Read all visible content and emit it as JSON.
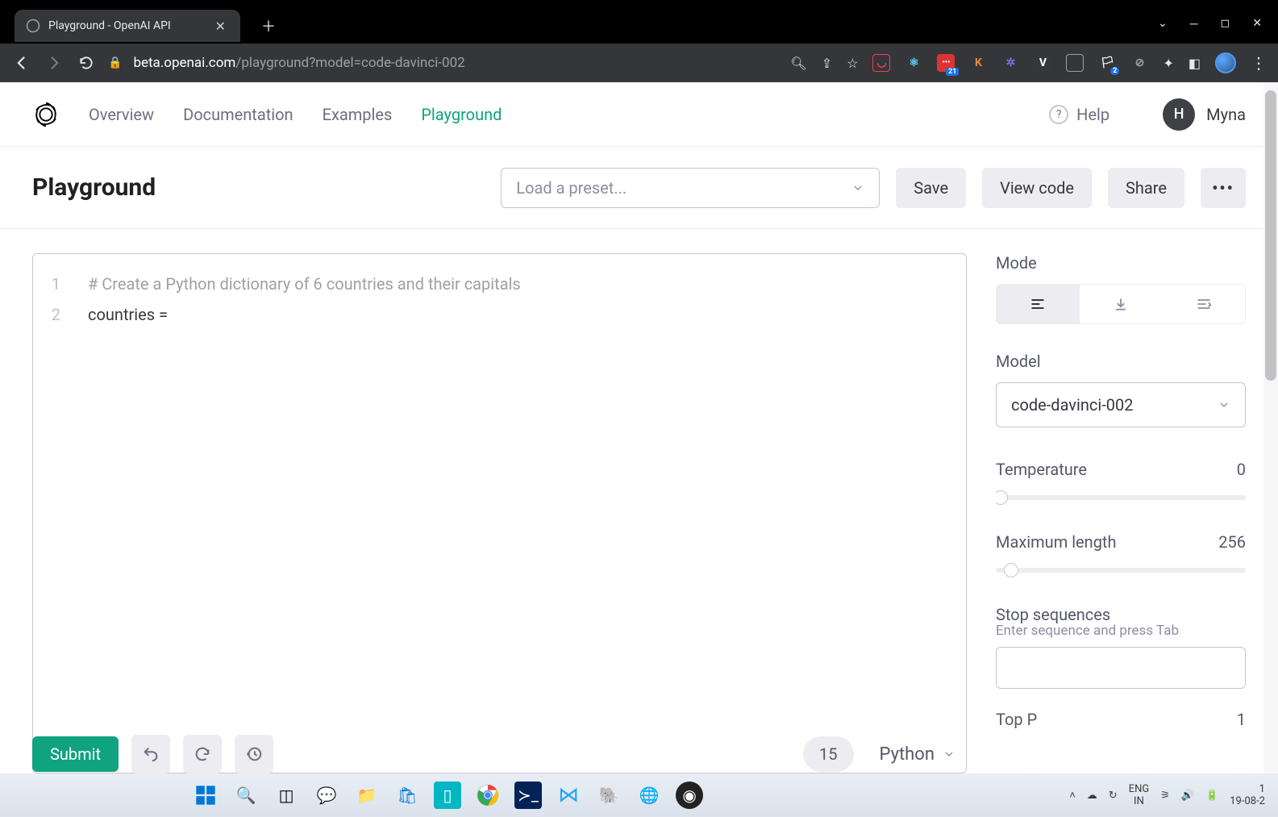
{
  "browser": {
    "tabTitle": "Playground - OpenAI API",
    "urlHost": "beta.openai.com",
    "urlPath": "/playground?model=code-davinci-002",
    "extBadge": "21",
    "extK": "K",
    "extV": "V"
  },
  "nav": {
    "links": [
      "Overview",
      "Documentation",
      "Examples",
      "Playground"
    ],
    "activeIndex": 3,
    "help": "Help",
    "userInitial": "H",
    "userName": "Myna"
  },
  "subhead": {
    "title": "Playground",
    "presetPlaceholder": "Load a preset...",
    "save": "Save",
    "viewcode": "View code",
    "share": "Share"
  },
  "editor": {
    "lines": [
      {
        "n": "1",
        "text": "# Create a Python dictionary of 6 countries and their capitals",
        "cls": "comment"
      },
      {
        "n": "2",
        "text": "countries =",
        "cls": ""
      }
    ]
  },
  "sidebar": {
    "modeLabel": "Mode",
    "modelLabel": "Model",
    "modelValue": "code-davinci-002",
    "tempLabel": "Temperature",
    "tempValue": "0",
    "tempPct": 2,
    "maxLabel": "Maximum length",
    "maxValue": "256",
    "maxPct": 6,
    "stopLabel": "Stop sequences",
    "stopHint": "Enter sequence and press Tab",
    "topPLabel": "Top P",
    "topPValue": "1"
  },
  "bottom": {
    "submit": "Submit",
    "count": "15",
    "lang": "Python"
  },
  "taskbar": {
    "lang1": "ENG",
    "lang2": "IN",
    "time": "1",
    "date": "19-08-2"
  }
}
